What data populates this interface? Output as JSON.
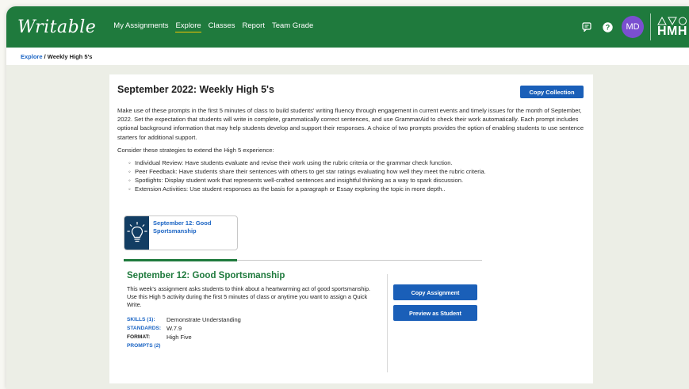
{
  "app": {
    "logo": "Writable"
  },
  "nav": {
    "items": [
      {
        "label": "My Assignments"
      },
      {
        "label": "Explore"
      },
      {
        "label": "Classes"
      },
      {
        "label": "Report"
      },
      {
        "label": "Team Grade"
      }
    ],
    "active": "Explore"
  },
  "header": {
    "avatar_initials": "MD",
    "brand": "HMH"
  },
  "breadcrumb": {
    "link": "Explore",
    "separator": "/",
    "current": "Weekly High 5's"
  },
  "collection": {
    "title": "September 2022: Weekly High 5's",
    "copy_button": "Copy Collection",
    "intro": "Make use of these prompts in the first 5 minutes of class to build students' writing fluency through engagement in current events and timely issues for the month of September, 2022. Set the expectation that students will write in complete, grammatically correct sentences, and use GrammarAid to check their work automatically. Each prompt includes optional background information that may help students develop and support their responses. A choice of two prompts provides the option of enabling students to use sentence starters for additional support.",
    "strategies_heading": "Consider these strategies to extend the High 5 experience:",
    "strategies": [
      "Individual Review: Have students evaluate and revise their work using the rubric criteria or the grammar check function.",
      "Peer Feedback: Have students share their sentences with others to get star ratings evaluating how well they meet the rubric criteria.",
      "Spotlights: Display student work that represents well-crafted sentences and insightful thinking as a way to spark discussion.",
      "Extension Activities: Use student responses as the basis for a paragraph or Essay exploring the topic in more depth.."
    ]
  },
  "tile": {
    "label": "September 12: Good Sportsmanship"
  },
  "detail": {
    "title": "September 12: Good Sportsmanship",
    "description": "This week's assignment asks students to think about a heartwarming act of good sportsmanship. Use this High 5 activity during the first 5 minutes of class or anytime you want to assign a Quick Write.",
    "skills_key": "SKILLS (1):",
    "skills_val": "Demonstrate Understanding",
    "standards_key": "STANDARDS:",
    "standards_val": "W.7.9",
    "format_key": "FORMAT:",
    "format_val": "High Five",
    "prompts_key": "PROMPTS (2)",
    "copy_button": "Copy Assignment",
    "preview_button": "Preview as Student"
  },
  "colors": {
    "header_green": "#1f7a3d",
    "button_blue": "#1a5fb8",
    "avatar_purple": "#7a4fd0",
    "tile_navy": "#123d63"
  }
}
